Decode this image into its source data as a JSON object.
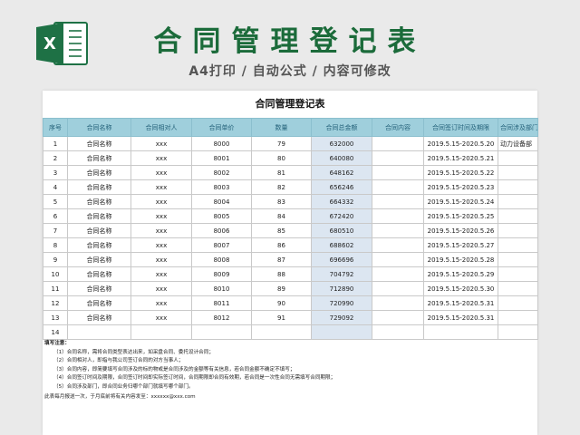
{
  "header": {
    "title": "合同管理登记表",
    "subtitle": "A4打印 / 自动公式 / 内容可修改",
    "logo_icon": "excel-logo-icon",
    "logo_color": "#1e7145"
  },
  "sheet": {
    "title": "合同管理登记表",
    "columns": [
      "序号",
      "合同名称",
      "合同相对人",
      "合同单价",
      "数量",
      "合同总金额",
      "合同内容",
      "合同签订时间及期限",
      "合同涉及部门"
    ],
    "rows": [
      [
        "1",
        "合同名称",
        "xxx",
        "8000",
        "79",
        "632000",
        "",
        "2019.5.15-2020.5.20",
        "动力设备部"
      ],
      [
        "2",
        "合同名称",
        "xxx",
        "8001",
        "80",
        "640080",
        "",
        "2019.5.15-2020.5.21",
        ""
      ],
      [
        "3",
        "合同名称",
        "xxx",
        "8002",
        "81",
        "648162",
        "",
        "2019.5.15-2020.5.22",
        ""
      ],
      [
        "4",
        "合同名称",
        "xxx",
        "8003",
        "82",
        "656246",
        "",
        "2019.5.15-2020.5.23",
        ""
      ],
      [
        "5",
        "合同名称",
        "xxx",
        "8004",
        "83",
        "664332",
        "",
        "2019.5.15-2020.5.24",
        ""
      ],
      [
        "6",
        "合同名称",
        "xxx",
        "8005",
        "84",
        "672420",
        "",
        "2019.5.15-2020.5.25",
        ""
      ],
      [
        "7",
        "合同名称",
        "xxx",
        "8006",
        "85",
        "680510",
        "",
        "2019.5.15-2020.5.26",
        ""
      ],
      [
        "8",
        "合同名称",
        "xxx",
        "8007",
        "86",
        "688602",
        "",
        "2019.5.15-2020.5.27",
        ""
      ],
      [
        "9",
        "合同名称",
        "xxx",
        "8008",
        "87",
        "696696",
        "",
        "2019.5.15-2020.5.28",
        ""
      ],
      [
        "10",
        "合同名称",
        "xxx",
        "8009",
        "88",
        "704792",
        "",
        "2019.5.15-2020.5.29",
        ""
      ],
      [
        "11",
        "合同名称",
        "xxx",
        "8010",
        "89",
        "712890",
        "",
        "2019.5.15-2020.5.30",
        ""
      ],
      [
        "12",
        "合同名称",
        "xxx",
        "8011",
        "90",
        "720990",
        "",
        "2019.5.15-2020.5.31",
        ""
      ],
      [
        "13",
        "合同名称",
        "xxx",
        "8012",
        "91",
        "729092",
        "",
        "2019.5.15-2020.5.31",
        ""
      ],
      [
        "14",
        "",
        "",
        "",
        "",
        "",
        "",
        "",
        ""
      ]
    ],
    "amount_fill": "#dce6f1",
    "header_fill": "#9fcfdc"
  },
  "notes": {
    "heading": "填写注意：",
    "items": [
      "（1）合同名称，需将合同类型表达出来，如采盘合同、委托设计合同；",
      "（2）合同相对人，即指与我公司签订合同的对方当事人；",
      "（3）合同内容，即简要填写合同涉及的标的物或是合同涉及的金额等有关信息，若合同金额不确定不填写；",
      "（4）合同签订时间及期限，合同签订时间即实际签订时间，合同期限即合同有效期，若合同是一次性合同无需填写合同期限；",
      "（5）合同涉及部门，即合同业务归哪个部门就填写哪个部门。"
    ],
    "footer": "此表每月报送一次，于月底前将有关内容发至：xxxxxx@xxx.com"
  }
}
